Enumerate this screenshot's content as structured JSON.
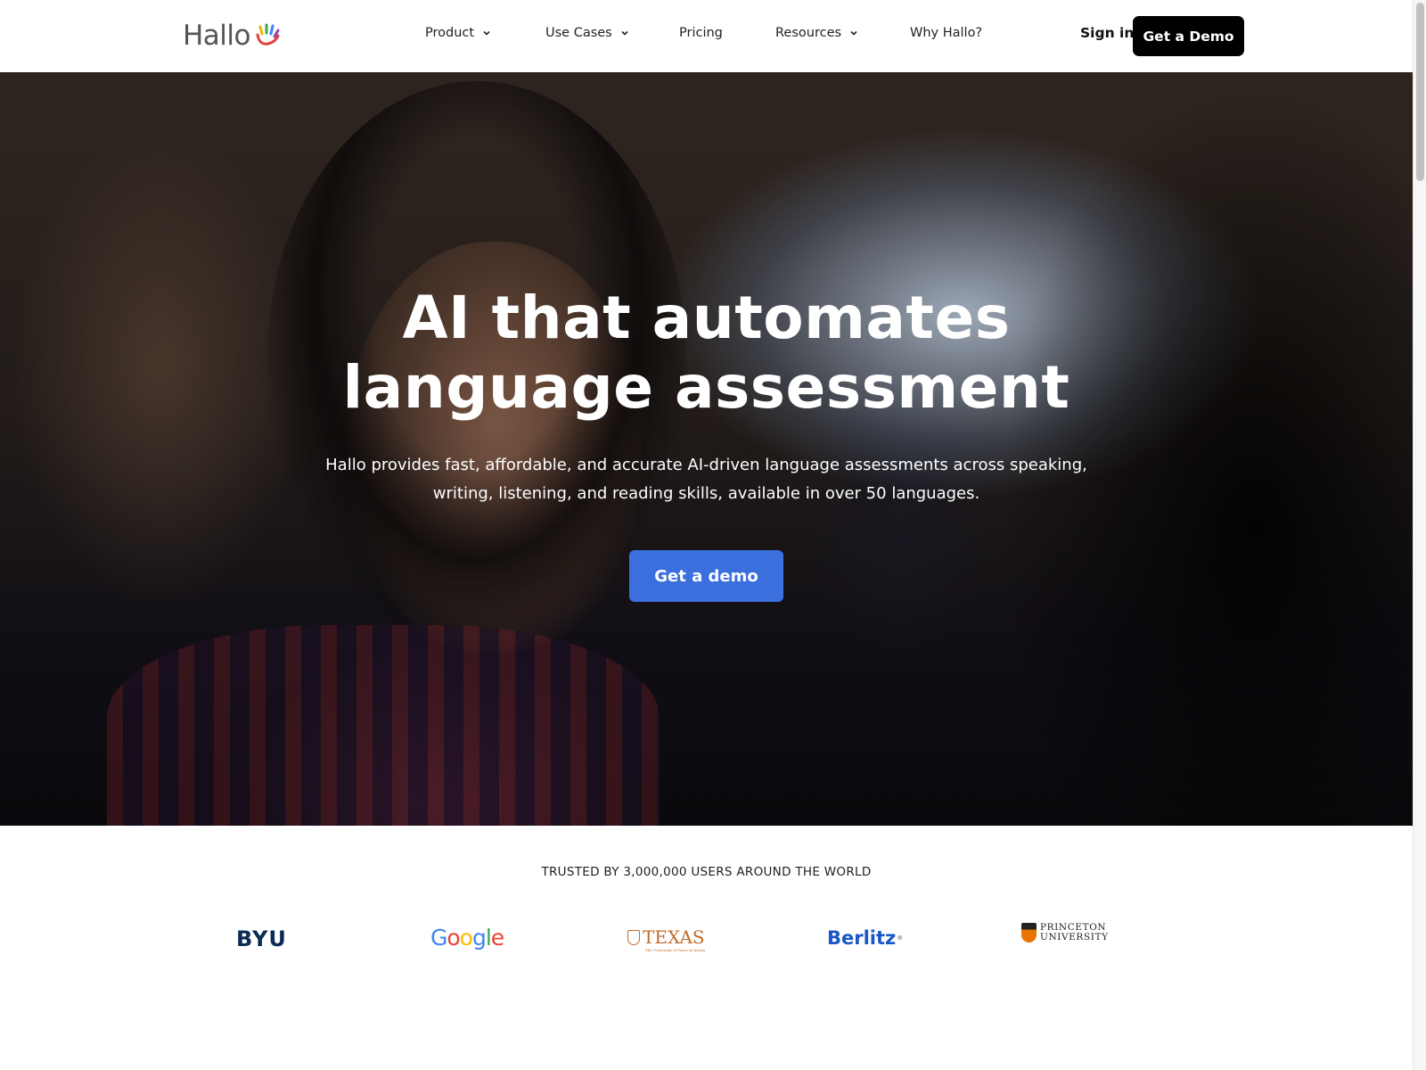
{
  "header": {
    "logo_text": "Hallo",
    "nav": [
      {
        "label": "Product",
        "has_dropdown": true
      },
      {
        "label": "Use Cases",
        "has_dropdown": true
      },
      {
        "label": "Pricing",
        "has_dropdown": false
      },
      {
        "label": "Resources",
        "has_dropdown": true
      },
      {
        "label": "Why Hallo?",
        "has_dropdown": false
      }
    ],
    "sign_in": "Sign in",
    "demo_button": "Get a Demo"
  },
  "hero": {
    "title_line1": "AI that automates",
    "title_line2": "language assessment",
    "subtitle": "Hallo provides fast, affordable, and accurate AI-driven language assessments across speaking, writing, listening, and reading skills, available in over 50 languages.",
    "cta": "Get a demo",
    "cta_color": "#3b6fde"
  },
  "trusted": {
    "heading": "TRUSTED BY 3,000,000 USERS AROUND THE WORLD",
    "clients": [
      {
        "name": "BYU",
        "text": "BYU"
      },
      {
        "name": "Google",
        "text": "Google"
      },
      {
        "name": "Texas",
        "text": "TEXAS",
        "tagline": "The University of Texas at Austin"
      },
      {
        "name": "Berlitz",
        "text": "Berlitz",
        "mark": "®"
      },
      {
        "name": "Princeton",
        "line1": "PRINCETON",
        "line2": "UNIVERSITY"
      }
    ]
  },
  "colors": {
    "primary_blue": "#3b6fde",
    "header_button": "#000000",
    "byu_navy": "#0c2c55",
    "texas_orange": "#c06b2c",
    "berlitz_blue": "#1a56c7",
    "princeton_orange": "#e77500"
  }
}
